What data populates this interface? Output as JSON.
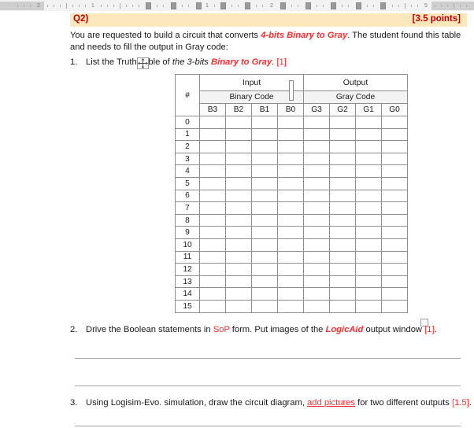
{
  "ruler": {
    "name": "document-ruler",
    "numbers": [
      "2",
      "1",
      "1",
      "2",
      "5"
    ],
    "tab_stop_count": 9
  },
  "question": {
    "label": "Q2)",
    "points": "[3.5 points]"
  },
  "intro": {
    "line1_part1": "You are requested to build a circuit that converts ",
    "line1_em": "4-bits Binary to ",
    "line1_em_bold": "Gray",
    "line1_part2": ". The student found this table",
    "line2": "and needs to fill the output in Gray code:"
  },
  "items": [
    {
      "number": "1.",
      "text_part1": "List the Truth Table of ",
      "text_italic": "the 3-bits ",
      "text_red_italic": "Binary to Gray",
      "text_part2": ". ",
      "mark": "[1]"
    },
    {
      "number": "2.",
      "text_part1": "Drive the Boolean statements in ",
      "text_red": "SoP",
      "text_part2": " form. Put images of the ",
      "text_red_italic": "LogicAid",
      "text_part3": " output window ",
      "mark": "[1]",
      "text_end": "."
    },
    {
      "number": "3.",
      "text_part1": "Using Logisim-Evo. simulation, draw the circuit diagram, ",
      "text_red_underline": "add pictures",
      "text_part2": " for two different outputs ",
      "mark": "[1.5]",
      "text_end": "."
    }
  ],
  "truth_table": {
    "name": "binary-to-gray-truth-table",
    "index_header": "#",
    "group_headers": [
      "Input",
      "Output"
    ],
    "sub_headers": [
      "Binary Code",
      "Gray Code"
    ],
    "bit_headers": [
      "B3",
      "B2",
      "B1",
      "B0",
      "G3",
      "G2",
      "G1",
      "G0"
    ],
    "row_indices": [
      "0",
      "1",
      "2",
      "3",
      "4",
      "5",
      "6",
      "7",
      "8",
      "9",
      "10",
      "11",
      "12",
      "13",
      "14",
      "15"
    ],
    "cells": [
      [
        "",
        "",
        "",
        "",
        "",
        "",
        "",
        ""
      ],
      [
        "",
        "",
        "",
        "",
        "",
        "",
        "",
        ""
      ],
      [
        "",
        "",
        "",
        "",
        "",
        "",
        "",
        ""
      ],
      [
        "",
        "",
        "",
        "",
        "",
        "",
        "",
        ""
      ],
      [
        "",
        "",
        "",
        "",
        "",
        "",
        "",
        ""
      ],
      [
        "",
        "",
        "",
        "",
        "",
        "",
        "",
        ""
      ],
      [
        "",
        "",
        "",
        "",
        "",
        "",
        "",
        ""
      ],
      [
        "",
        "",
        "",
        "",
        "",
        "",
        "",
        ""
      ],
      [
        "",
        "",
        "",
        "",
        "",
        "",
        "",
        ""
      ],
      [
        "",
        "",
        "",
        "",
        "",
        "",
        "",
        ""
      ],
      [
        "",
        "",
        "",
        "",
        "",
        "",
        "",
        ""
      ],
      [
        "",
        "",
        "",
        "",
        "",
        "",
        "",
        ""
      ],
      [
        "",
        "",
        "",
        "",
        "",
        "",
        "",
        ""
      ],
      [
        "",
        "",
        "",
        "",
        "",
        "",
        "",
        ""
      ],
      [
        "",
        "",
        "",
        "",
        "",
        "",
        "",
        ""
      ],
      [
        "",
        "",
        "",
        "",
        "",
        "",
        "",
        ""
      ]
    ]
  },
  "colors": {
    "highlight_band": "#fde7bd",
    "accent_red": "#c00000",
    "emphasis_red": "#ff2d2d",
    "table_border": "#8e8e8e",
    "ruler_bg": "#f2f2f2"
  }
}
